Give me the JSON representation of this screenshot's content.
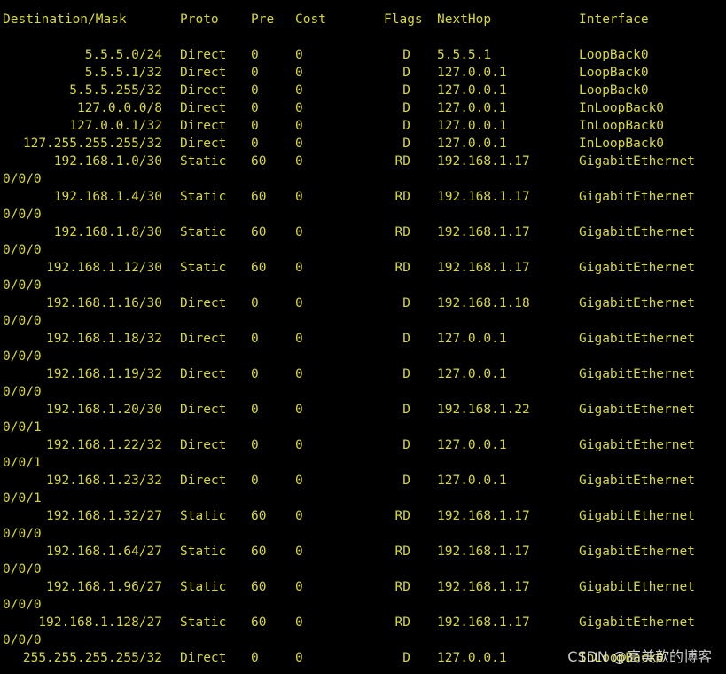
{
  "colors": {
    "background": "#000000",
    "text": "#d8d838",
    "watermark": "#ebebeb"
  },
  "header": {
    "destination": "Destination/Mask",
    "proto": "Proto",
    "pre": "Pre",
    "cost": "Cost",
    "flags": "Flags",
    "nexthop": "NextHop",
    "interface": "Interface"
  },
  "routes": [
    {
      "dest": "5.5.5.0/24",
      "proto": "Direct",
      "pre": "0",
      "cost": "0",
      "flags": "D",
      "nexthop": "5.5.5.1",
      "iface": "LoopBack0",
      "cont": ""
    },
    {
      "dest": "5.5.5.1/32",
      "proto": "Direct",
      "pre": "0",
      "cost": "0",
      "flags": "D",
      "nexthop": "127.0.0.1",
      "iface": "LoopBack0",
      "cont": ""
    },
    {
      "dest": "5.5.5.255/32",
      "proto": "Direct",
      "pre": "0",
      "cost": "0",
      "flags": "D",
      "nexthop": "127.0.0.1",
      "iface": "LoopBack0",
      "cont": ""
    },
    {
      "dest": "127.0.0.0/8",
      "proto": "Direct",
      "pre": "0",
      "cost": "0",
      "flags": "D",
      "nexthop": "127.0.0.1",
      "iface": "InLoopBack0",
      "cont": ""
    },
    {
      "dest": "127.0.0.1/32",
      "proto": "Direct",
      "pre": "0",
      "cost": "0",
      "flags": "D",
      "nexthop": "127.0.0.1",
      "iface": "InLoopBack0",
      "cont": ""
    },
    {
      "dest": "127.255.255.255/32",
      "proto": "Direct",
      "pre": "0",
      "cost": "0",
      "flags": "D",
      "nexthop": "127.0.0.1",
      "iface": "InLoopBack0",
      "cont": ""
    },
    {
      "dest": "192.168.1.0/30",
      "proto": "Static",
      "pre": "60",
      "cost": "0",
      "flags": "RD",
      "nexthop": "192.168.1.17",
      "iface": "GigabitEthernet",
      "cont": "0/0/0"
    },
    {
      "dest": "192.168.1.4/30",
      "proto": "Static",
      "pre": "60",
      "cost": "0",
      "flags": "RD",
      "nexthop": "192.168.1.17",
      "iface": "GigabitEthernet",
      "cont": "0/0/0"
    },
    {
      "dest": "192.168.1.8/30",
      "proto": "Static",
      "pre": "60",
      "cost": "0",
      "flags": "RD",
      "nexthop": "192.168.1.17",
      "iface": "GigabitEthernet",
      "cont": "0/0/0"
    },
    {
      "dest": "192.168.1.12/30",
      "proto": "Static",
      "pre": "60",
      "cost": "0",
      "flags": "RD",
      "nexthop": "192.168.1.17",
      "iface": "GigabitEthernet",
      "cont": "0/0/0"
    },
    {
      "dest": "192.168.1.16/30",
      "proto": "Direct",
      "pre": "0",
      "cost": "0",
      "flags": "D",
      "nexthop": "192.168.1.18",
      "iface": "GigabitEthernet",
      "cont": "0/0/0"
    },
    {
      "dest": "192.168.1.18/32",
      "proto": "Direct",
      "pre": "0",
      "cost": "0",
      "flags": "D",
      "nexthop": "127.0.0.1",
      "iface": "GigabitEthernet",
      "cont": "0/0/0"
    },
    {
      "dest": "192.168.1.19/32",
      "proto": "Direct",
      "pre": "0",
      "cost": "0",
      "flags": "D",
      "nexthop": "127.0.0.1",
      "iface": "GigabitEthernet",
      "cont": "0/0/0"
    },
    {
      "dest": "192.168.1.20/30",
      "proto": "Direct",
      "pre": "0",
      "cost": "0",
      "flags": "D",
      "nexthop": "192.168.1.22",
      "iface": "GigabitEthernet",
      "cont": "0/0/1"
    },
    {
      "dest": "192.168.1.22/32",
      "proto": "Direct",
      "pre": "0",
      "cost": "0",
      "flags": "D",
      "nexthop": "127.0.0.1",
      "iface": "GigabitEthernet",
      "cont": "0/0/1"
    },
    {
      "dest": "192.168.1.23/32",
      "proto": "Direct",
      "pre": "0",
      "cost": "0",
      "flags": "D",
      "nexthop": "127.0.0.1",
      "iface": "GigabitEthernet",
      "cont": "0/0/1"
    },
    {
      "dest": "192.168.1.32/27",
      "proto": "Static",
      "pre": "60",
      "cost": "0",
      "flags": "RD",
      "nexthop": "192.168.1.17",
      "iface": "GigabitEthernet",
      "cont": "0/0/0"
    },
    {
      "dest": "192.168.1.64/27",
      "proto": "Static",
      "pre": "60",
      "cost": "0",
      "flags": "RD",
      "nexthop": "192.168.1.17",
      "iface": "GigabitEthernet",
      "cont": "0/0/0"
    },
    {
      "dest": "192.168.1.96/27",
      "proto": "Static",
      "pre": "60",
      "cost": "0",
      "flags": "RD",
      "nexthop": "192.168.1.17",
      "iface": "GigabitEthernet",
      "cont": "0/0/0"
    },
    {
      "dest": "192.168.1.128/27",
      "proto": "Static",
      "pre": "60",
      "cost": "0",
      "flags": "RD",
      "nexthop": "192.168.1.17",
      "iface": "GigabitEthernet",
      "cont": "0/0/0"
    },
    {
      "dest": "255.255.255.255/32",
      "proto": "Direct",
      "pre": "0",
      "cost": "0",
      "flags": "D",
      "nexthop": "127.0.0.1",
      "iface": "InLoopBack0",
      "cont": ""
    }
  ],
  "watermark": "CSDN @高美歆的博客"
}
